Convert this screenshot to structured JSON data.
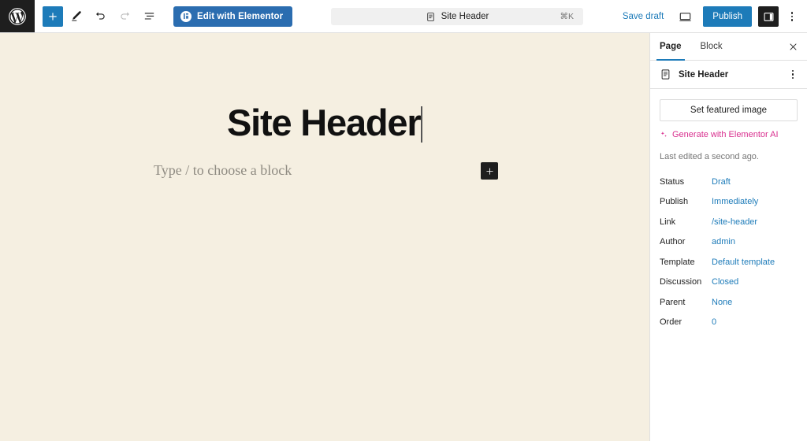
{
  "topbar": {
    "wp_logo": "wordpress-logo",
    "add_block_label": "+",
    "tools_label": "Tools",
    "undo_label": "Undo",
    "redo_label": "Redo",
    "list_view_label": "Document Overview",
    "elementor_button": "Edit with Elementor",
    "command_bar": {
      "title": "Site Header",
      "shortcut": "⌘K"
    },
    "save_draft": "Save draft",
    "view_label": "View",
    "publish": "Publish",
    "settings_toggle_label": "Settings",
    "options_label": "Options"
  },
  "canvas": {
    "background_color": "#f5efe1",
    "post_title": "Site Header",
    "block_placeholder": "Type / to choose a block",
    "inserter_label": "+"
  },
  "sidebar": {
    "tabs": [
      {
        "label": "Page",
        "active": true
      },
      {
        "label": "Block",
        "active": false
      }
    ],
    "close_label": "Close settings",
    "document": {
      "icon": "page-icon",
      "title": "Site Header",
      "actions_label": "Actions"
    },
    "featured_image_button": "Set featured image",
    "ai_link": "Generate with Elementor AI",
    "ai_link_color": "#d9308f",
    "last_edited": "Last edited a second ago.",
    "status_rows": [
      {
        "label": "Status",
        "value": "Draft"
      },
      {
        "label": "Publish",
        "value": "Immediately"
      },
      {
        "label": "Link",
        "value": "/site-header"
      },
      {
        "label": "Author",
        "value": "admin"
      },
      {
        "label": "Template",
        "value": "Default template"
      },
      {
        "label": "Discussion",
        "value": "Closed"
      },
      {
        "label": "Parent",
        "value": "None"
      },
      {
        "label": "Order",
        "value": "0"
      }
    ]
  },
  "colors": {
    "accent_blue": "#1d7bb9",
    "elementor_blue": "#2b6db0",
    "dark": "#1e1e1e",
    "link_blue": "#1d7bb9"
  }
}
